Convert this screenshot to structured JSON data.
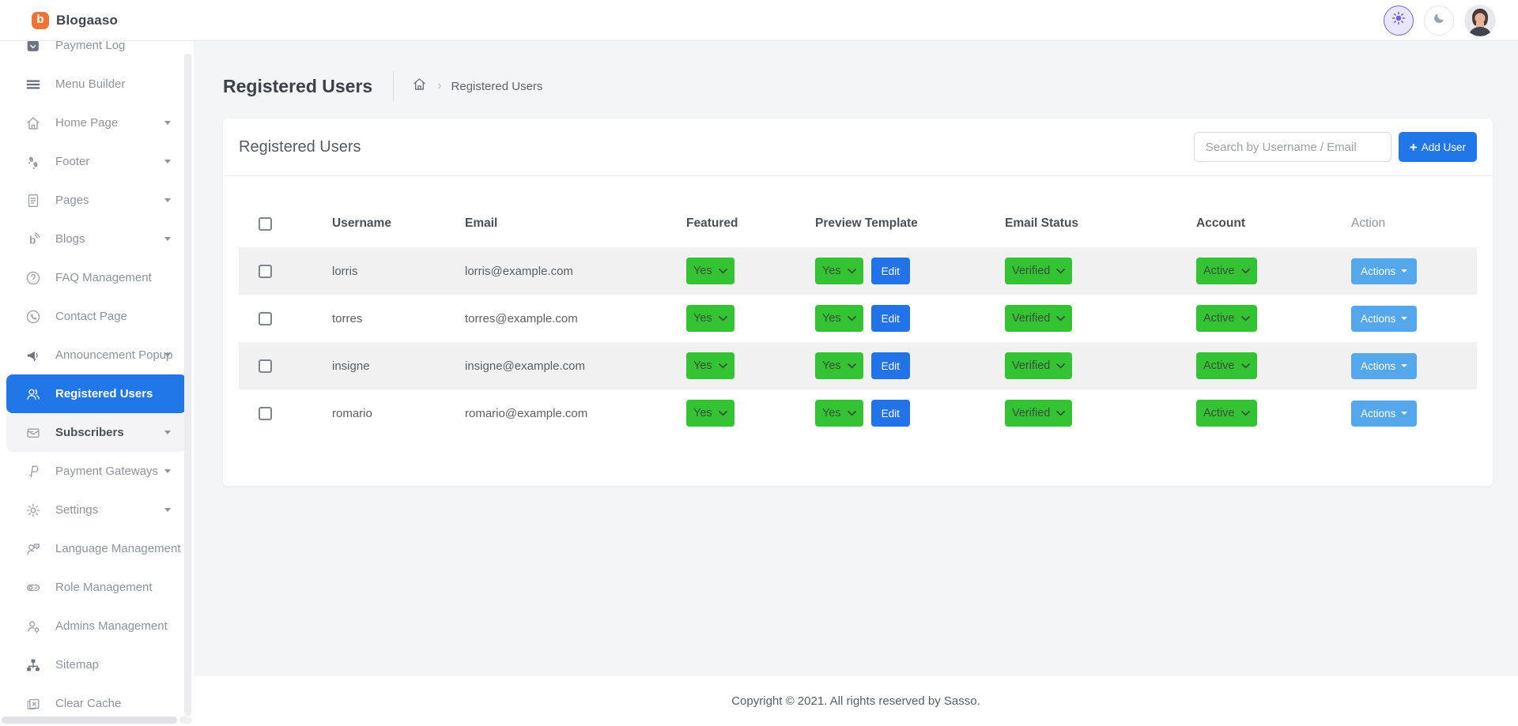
{
  "brand": {
    "name": "Blogaaso"
  },
  "topbar": {
    "theme_light_icon": "sun",
    "theme_dark_icon": "moon",
    "avatar": "user-avatar"
  },
  "sidebar": {
    "items": [
      {
        "label": "Payment Log",
        "icon": "payment-log",
        "expandable": false
      },
      {
        "label": "Menu Builder",
        "icon": "menu",
        "expandable": false
      },
      {
        "label": "Home Page",
        "icon": "home",
        "expandable": true
      },
      {
        "label": "Footer",
        "icon": "footprints",
        "expandable": true
      },
      {
        "label": "Pages",
        "icon": "file",
        "expandable": true
      },
      {
        "label": "Blogs",
        "icon": "blog",
        "expandable": true
      },
      {
        "label": "FAQ Management",
        "icon": "question",
        "expandable": false
      },
      {
        "label": "Contact Page",
        "icon": "phone",
        "expandable": false
      },
      {
        "label": "Announcement Popup",
        "icon": "megaphone",
        "expandable": true
      },
      {
        "label": "Registered Users",
        "icon": "users",
        "expandable": false,
        "active": true
      },
      {
        "label": "Subscribers",
        "icon": "mail",
        "expandable": true,
        "highlighted": true
      },
      {
        "label": "Payment Gateways",
        "icon": "paypal",
        "expandable": true
      },
      {
        "label": "Settings",
        "icon": "gear",
        "expandable": true
      },
      {
        "label": "Language Management",
        "icon": "language",
        "expandable": false
      },
      {
        "label": "Role Management",
        "icon": "toggle",
        "expandable": false
      },
      {
        "label": "Admins Management",
        "icon": "admin",
        "expandable": false
      },
      {
        "label": "Sitemap",
        "icon": "sitemap",
        "expandable": false
      },
      {
        "label": "Clear Cache",
        "icon": "clear-cache",
        "expandable": false
      }
    ]
  },
  "page": {
    "title": "Registered Users",
    "breadcrumb_current": "Registered Users"
  },
  "card": {
    "title": "Registered Users",
    "search_placeholder": "Search by Username / Email",
    "add_user_label": "Add User"
  },
  "table": {
    "columns": [
      "Username",
      "Email",
      "Featured",
      "Preview Template",
      "Email Status",
      "Account",
      "Action"
    ],
    "edit_label": "Edit",
    "actions_label": "Actions",
    "rows": [
      {
        "username": "lorris",
        "email": "lorris@example.com",
        "featured": "Yes",
        "preview_template": "Yes",
        "email_status": "Verified",
        "account": "Active"
      },
      {
        "username": "torres",
        "email": "torres@example.com",
        "featured": "Yes",
        "preview_template": "Yes",
        "email_status": "Verified",
        "account": "Active"
      },
      {
        "username": "insigne",
        "email": "insigne@example.com",
        "featured": "Yes",
        "preview_template": "Yes",
        "email_status": "Verified",
        "account": "Active"
      },
      {
        "username": "romario",
        "email": "romario@example.com",
        "featured": "Yes",
        "preview_template": "Yes",
        "email_status": "Verified",
        "account": "Active"
      }
    ]
  },
  "footer": {
    "copyright": "Copyright © 2021. All rights reserved by Sasso."
  },
  "colors": {
    "accent_blue": "#2176e8",
    "light_blue": "#54a7ea",
    "green": "#33c333",
    "brand_orange": "#ee7434",
    "sidebar_active": "#2176e8",
    "row_stripe": "#f1f1f2"
  }
}
